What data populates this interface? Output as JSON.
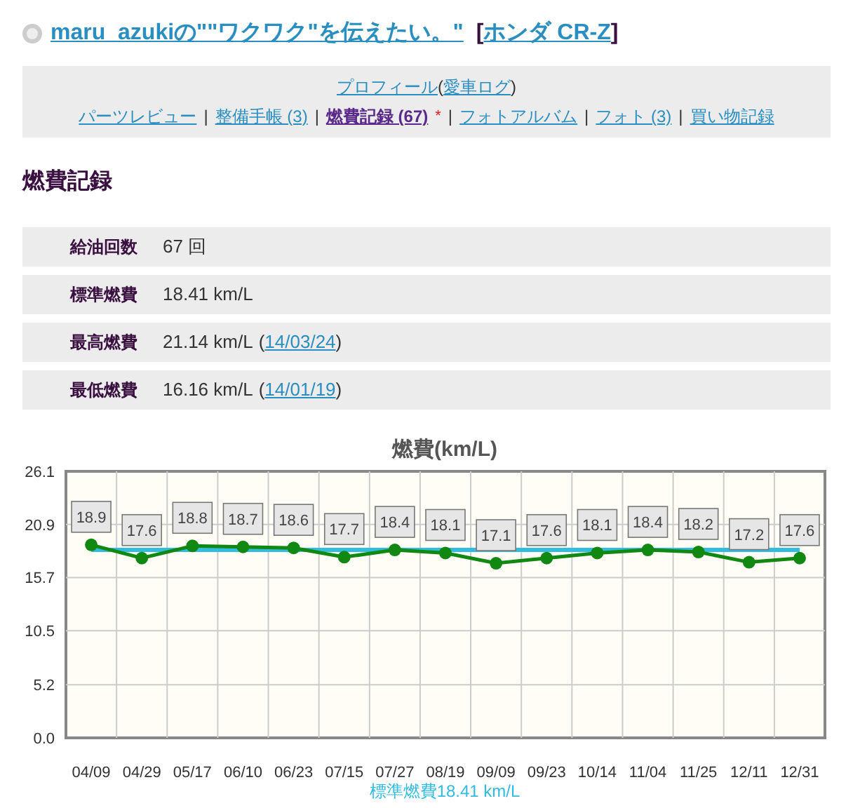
{
  "header": {
    "title": "maru_azukiの\"\"ワクワク\"を伝えたい。\"",
    "open": "[",
    "car": "ホンダ CR-Z",
    "close": "]"
  },
  "nav": [
    {
      "items": [
        {
          "kind": "link",
          "text": "プロフィール",
          "selected": false
        },
        {
          "kind": "text",
          "text": "("
        },
        {
          "kind": "link",
          "text": "愛車ログ",
          "selected": false
        },
        {
          "kind": "text",
          "text": ")"
        }
      ]
    },
    {
      "items": [
        {
          "kind": "link",
          "text": "パーツレビュー",
          "selected": false
        },
        {
          "kind": "sep",
          "text": "|"
        },
        {
          "kind": "link",
          "text": "整備手帳 (3)",
          "selected": false
        },
        {
          "kind": "sep",
          "text": "|"
        },
        {
          "kind": "link",
          "text": "燃費記録 (67)",
          "selected": true
        },
        {
          "kind": "marker",
          "text": "*"
        },
        {
          "kind": "sep",
          "text": "|"
        },
        {
          "kind": "link",
          "text": "フォトアルバム",
          "selected": false
        },
        {
          "kind": "sep",
          "text": "|"
        },
        {
          "kind": "link",
          "text": "フォト (3)",
          "selected": false
        },
        {
          "kind": "sep",
          "text": "|"
        },
        {
          "kind": "link",
          "text": "買い物記録",
          "selected": false
        }
      ]
    }
  ],
  "section_title": "燃費記録",
  "stats": [
    {
      "label": "給油回数",
      "value": "67 回"
    },
    {
      "label": "標準燃費",
      "value": "18.41 km/L"
    },
    {
      "label": "最高燃費",
      "value": "21.14 km/L",
      "open": "(",
      "date": "14/03/24",
      "close": ")"
    },
    {
      "label": "最低燃費",
      "value": "16.16 km/L",
      "open": "(",
      "date": "14/01/19",
      "close": ")"
    }
  ],
  "chart_data": {
    "type": "line",
    "title": "燃費(km/L)",
    "categories": [
      "04/09",
      "04/29",
      "05/17",
      "06/10",
      "06/23",
      "07/15",
      "07/27",
      "08/19",
      "09/09",
      "09/23",
      "10/14",
      "11/04",
      "11/25",
      "12/11",
      "12/31"
    ],
    "series": [
      {
        "name": "標準燃費18.41 km/L",
        "color": "#33bbe0",
        "values": [
          18.41,
          18.41,
          18.41,
          18.41,
          18.41,
          18.41,
          18.41,
          18.41,
          18.41,
          18.41,
          18.41,
          18.41,
          18.41,
          18.41,
          18.41
        ]
      },
      {
        "color": "#118811",
        "marker": "circle",
        "data_labels": true,
        "values": [
          18.9,
          17.6,
          18.8,
          18.7,
          18.6,
          17.7,
          18.4,
          18.1,
          17.1,
          17.6,
          18.1,
          18.4,
          18.2,
          17.2,
          17.6
        ]
      }
    ],
    "ylim": [
      0,
      26.1
    ],
    "yticks": [
      {
        "value": 0,
        "label": "0.0"
      },
      5.2,
      10.5,
      15.7,
      20.9,
      26.1
    ],
    "grid": true
  }
}
